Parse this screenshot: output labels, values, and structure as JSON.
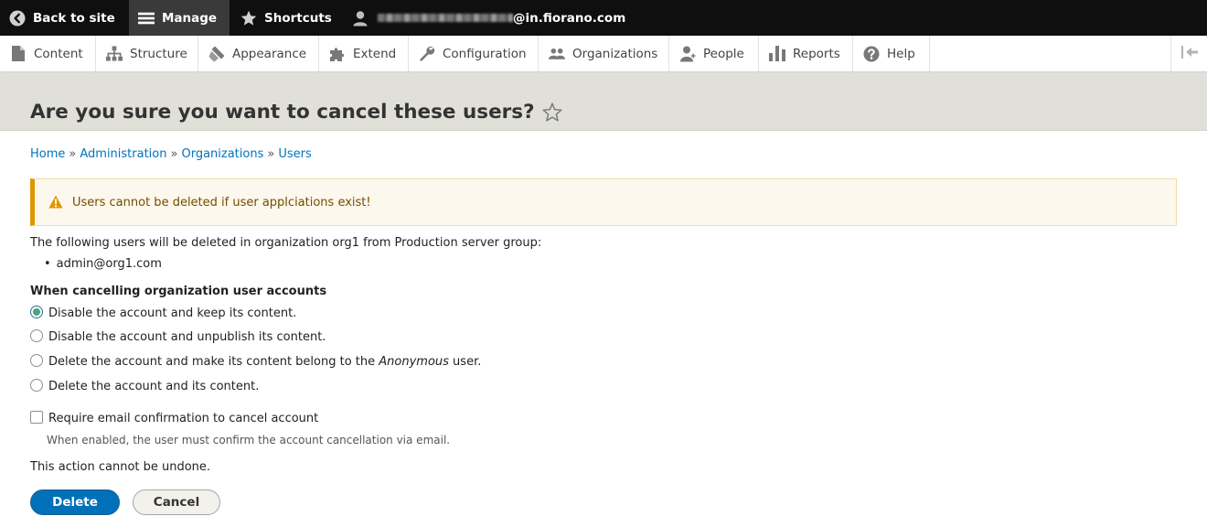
{
  "toolbar": {
    "back_label": "Back to site",
    "manage_label": "Manage",
    "shortcuts_label": "Shortcuts",
    "user_email_suffix": "@in.fiorano.com"
  },
  "tray": {
    "items": [
      {
        "label": "Content",
        "icon": "file-icon"
      },
      {
        "label": "Structure",
        "icon": "sitemap-icon"
      },
      {
        "label": "Appearance",
        "icon": "paintbrush-icon"
      },
      {
        "label": "Extend",
        "icon": "puzzle-icon"
      },
      {
        "label": "Configuration",
        "icon": "wrench-icon"
      },
      {
        "label": "Organizations",
        "icon": "people-icon"
      },
      {
        "label": "People",
        "icon": "person-icon"
      },
      {
        "label": "Reports",
        "icon": "bars-icon"
      },
      {
        "label": "Help",
        "icon": "question-icon"
      }
    ]
  },
  "page": {
    "title": "Are you sure you want to cancel these users?"
  },
  "breadcrumb": {
    "items": [
      "Home",
      "Administration",
      "Organizations",
      "Users"
    ],
    "separator": "»"
  },
  "warning": {
    "message": "Users cannot be deleted if user applciations exist!"
  },
  "body": {
    "intro": "The following users will be deleted in organization org1 from Production server group:",
    "users": [
      "admin@org1.com"
    ],
    "legend": "When cancelling organization user accounts",
    "options": [
      {
        "label": "Disable the account and keep its content.",
        "checked": true
      },
      {
        "label": "Disable the account and unpublish its content.",
        "checked": false
      },
      {
        "label_before": "Delete the account and make its content belong to the ",
        "label_em": "Anonymous",
        "label_after": " user.",
        "checked": false
      },
      {
        "label": "Delete the account and its content.",
        "checked": false
      }
    ],
    "checkbox_label": "Require email confirmation to cancel account",
    "checkbox_desc": "When enabled, the user must confirm the account cancellation via email.",
    "final_note": "This action cannot be undone."
  },
  "actions": {
    "delete_label": "Delete",
    "cancel_label": "Cancel"
  },
  "colors": {
    "toolbar_bg": "#0f0f0f",
    "link": "#0074bd",
    "warning_border": "#e09600",
    "primary_button": "#0071b8"
  }
}
